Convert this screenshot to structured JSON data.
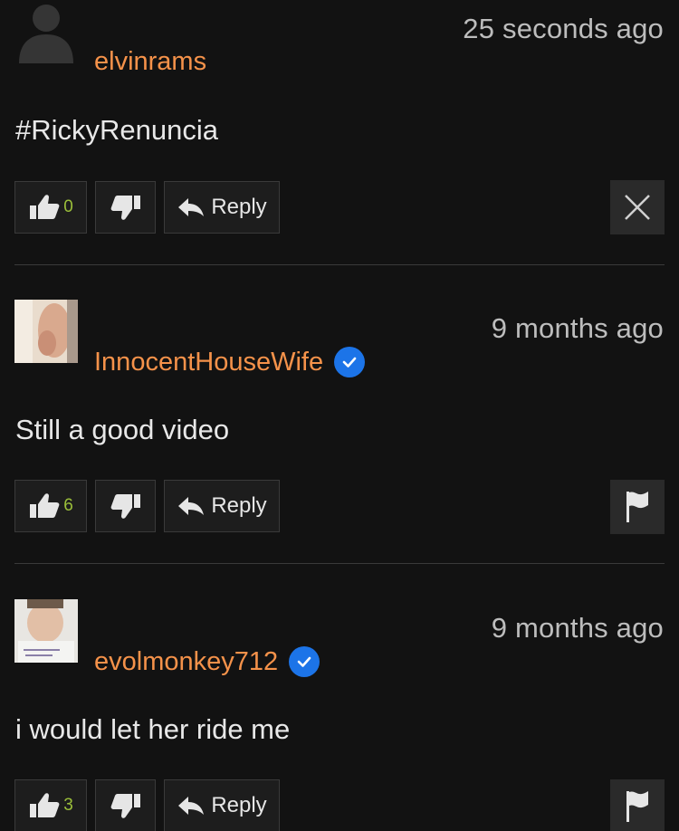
{
  "comments": [
    {
      "timestamp": "25 seconds ago",
      "username": "elvinrams",
      "verified": false,
      "text": "#RickyRenuncia",
      "likes": "0",
      "reply_label": "Reply",
      "side_action": "delete",
      "avatar": "default-avatar"
    },
    {
      "timestamp": "9 months ago",
      "username": "InnocentHouseWife",
      "verified": true,
      "text": "Still a good video",
      "likes": "6",
      "reply_label": "Reply",
      "side_action": "flag",
      "avatar": "user-photo"
    },
    {
      "timestamp": "9 months ago",
      "username": "evolmonkey712",
      "verified": true,
      "text": "i would let her ride me",
      "likes": "3",
      "reply_label": "Reply",
      "side_action": "flag",
      "avatar": "user-photo"
    }
  ],
  "colors": {
    "background": "#121212",
    "username": "#f5924a",
    "like_count": "#9bbf3a",
    "verified_badge": "#1c74e8"
  }
}
